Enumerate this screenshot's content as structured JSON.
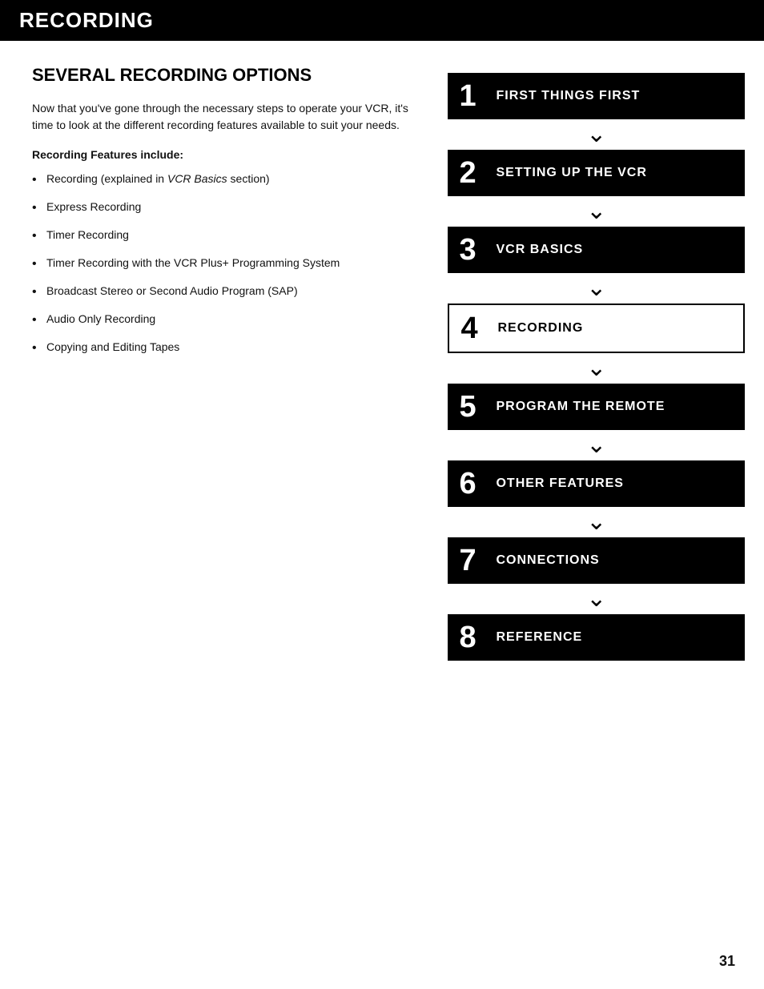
{
  "header": {
    "title": "RECORDING"
  },
  "left": {
    "section_title": "SEVERAL RECORDING OPTIONS",
    "intro": "Now that you've gone through the necessary steps to operate your VCR, it's time to look at the different recording features available to suit your needs.",
    "features_label": "Recording Features include:",
    "bullets": [
      {
        "text": "Recording (explained in ",
        "italic": "VCR Basics",
        "text2": " section)"
      },
      {
        "text": "Express Recording"
      },
      {
        "text": "Timer Recording"
      },
      {
        "text": "Timer Recording with the VCR Plus+ Programming System"
      },
      {
        "text": "Broadcast Stereo or Second Audio Program (SAP)"
      },
      {
        "text": "Audio Only Recording"
      },
      {
        "text": "Copying and Editing Tapes"
      }
    ]
  },
  "right": {
    "nav_items": [
      {
        "number": "1",
        "label": "FIRST THINGS FIRST",
        "style": "filled"
      },
      {
        "number": "2",
        "label": "SETTING UP THE VCR",
        "style": "filled"
      },
      {
        "number": "3",
        "label": "VCR BASICS",
        "style": "filled"
      },
      {
        "number": "4",
        "label": "RECORDING",
        "style": "outline"
      },
      {
        "number": "5",
        "label": "PROGRAM THE REMOTE",
        "style": "filled"
      },
      {
        "number": "6",
        "label": "OTHER FEATURES",
        "style": "filled"
      },
      {
        "number": "7",
        "label": "CONNECTIONS",
        "style": "filled"
      },
      {
        "number": "8",
        "label": "REFERENCE",
        "style": "filled"
      }
    ]
  },
  "page_number": "31"
}
